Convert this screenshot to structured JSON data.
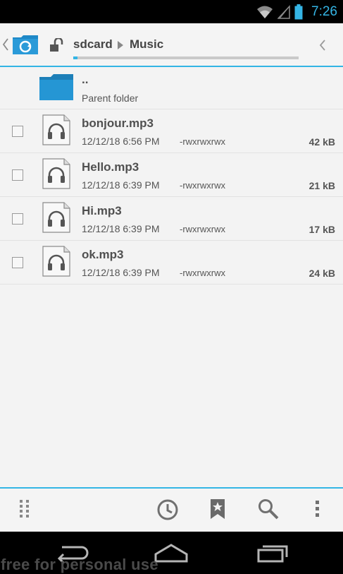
{
  "status_bar": {
    "time": "7:26",
    "icons": [
      "wifi-icon",
      "signal-icon",
      "battery-icon"
    ],
    "accent_color": "#35b5e5"
  },
  "header": {
    "breadcrumbs": [
      "sdcard",
      "Music"
    ],
    "path_progress": 0.02,
    "accent_color": "#33b5e5"
  },
  "parent_row": {
    "name": "..",
    "label": "Parent folder"
  },
  "files": [
    {
      "name": "bonjour.mp3",
      "date": "12/12/18 6:56 PM",
      "permissions": "-rwxrwxrwx",
      "size": "42 kB"
    },
    {
      "name": "Hello.mp3",
      "date": "12/12/18 6:39 PM",
      "permissions": "-rwxrwxrwx",
      "size": "21 kB"
    },
    {
      "name": "Hi.mp3",
      "date": "12/12/18 6:39 PM",
      "permissions": "-rwxrwxrwx",
      "size": "17 kB"
    },
    {
      "name": "ok.mp3",
      "date": "12/12/18 6:39 PM",
      "permissions": "-rwxrwxrwx",
      "size": "24 kB"
    }
  ],
  "toolbar": {
    "icons": [
      "drag-handle-icon",
      "history-icon",
      "bookmark-icon",
      "search-icon",
      "overflow-menu-icon"
    ]
  },
  "nav_bar": {
    "icons": [
      "back-icon",
      "home-icon",
      "recents-icon"
    ]
  },
  "watermark": "free for personal use"
}
